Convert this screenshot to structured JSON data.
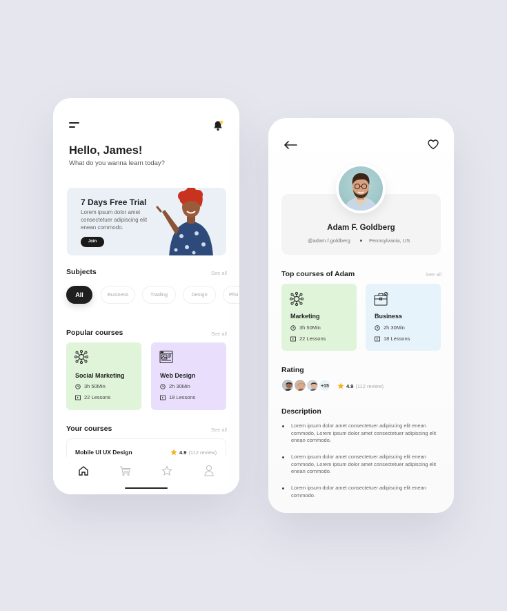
{
  "home": {
    "greeting": "Hello, James!",
    "subtitle": "What do you wanna learn today?",
    "trial": {
      "title": "7 Days Free Trial",
      "text": "Lorem ipsum dolor amet consectetuer adipiscing elit enean commodo.",
      "button": "Join"
    },
    "subjects": {
      "title": "Subjects",
      "see_all": "See all",
      "chips": [
        "All",
        "Business",
        "Trading",
        "Design",
        "Pho"
      ]
    },
    "popular": {
      "title": "Popular courses",
      "see_all": "See all",
      "cards": [
        {
          "title": "Social Marketing",
          "duration": "3h 50Min",
          "lessons": "22 Lessons",
          "color": "#dff4d9",
          "icon": "network-icon"
        },
        {
          "title": "Web Design",
          "duration": "2h 30Min",
          "lessons": "18 Lessons",
          "color": "#e9dffc",
          "icon": "web-layout-icon"
        }
      ]
    },
    "your_courses": {
      "title": "Your courses",
      "see_all": "See all",
      "item": {
        "title": "Mobile UI UX Design",
        "rating": "4.9",
        "reviews": "(112 review)"
      }
    },
    "nav": [
      "home-icon",
      "cart-icon",
      "star-icon",
      "user-icon"
    ]
  },
  "profile": {
    "name": "Adam F. Goldberg",
    "handle": "@adam.f.goldberg",
    "location": "Pennsylvania, US",
    "top_courses": {
      "title": "Top courses of Adam",
      "see_all": "See all",
      "cards": [
        {
          "title": "Marketing",
          "duration": "3h 50Min",
          "lessons": "22 Lessons",
          "color": "#dff4d9",
          "icon": "network-icon"
        },
        {
          "title": "Business",
          "duration": "2h 30Min",
          "lessons": "18 Lessons",
          "color": "#e6f3fb",
          "icon": "briefcase-icon"
        }
      ]
    },
    "rating": {
      "title": "Rating",
      "more": "+15",
      "value": "4.9",
      "reviews": "(112 review)"
    },
    "description": {
      "title": "Description",
      "items": [
        "Lorem ipsum dolor amet consectetuer adipiscing elit enean commodo, Lorem ipsum dolor amet consectetuer adipiscing elit enean commodo.",
        "Lorem ipsum dolor amet consectetuer adipiscing elit enean commodo, Lorem ipsum dolor amet consectetuer adipiscing elit enean commodo.",
        "Lorem ipsum dolor amet consectetuer adipiscing elit enean commodo."
      ]
    }
  },
  "colors": {
    "background": "#e6e6ee",
    "accent_dark": "#1f1f1f",
    "star": "#f5b01c",
    "notification_dot": "#f7d23e"
  }
}
